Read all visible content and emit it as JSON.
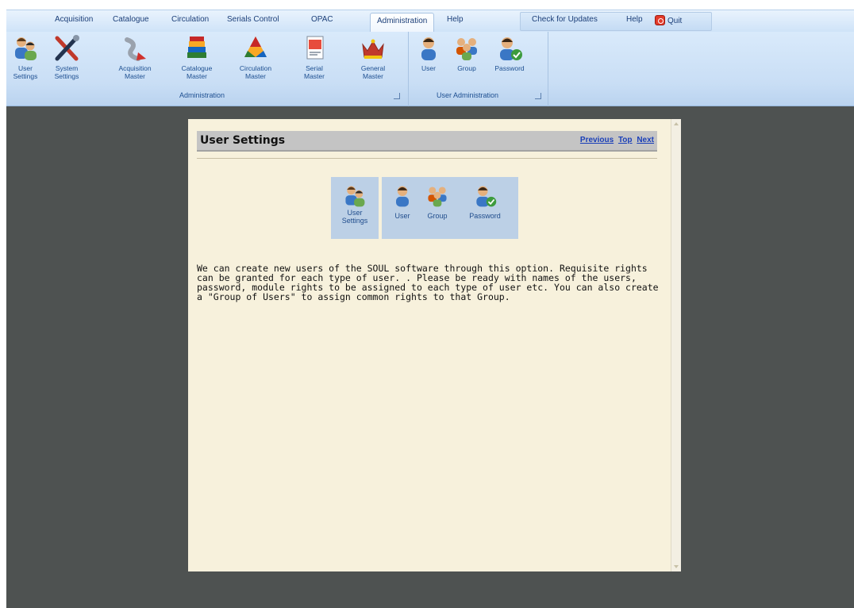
{
  "tabs": [
    {
      "label": "Acquisition",
      "active": false
    },
    {
      "label": "Catalogue",
      "active": false
    },
    {
      "label": "Circulation",
      "active": false
    },
    {
      "label": "Serials Control",
      "active": false
    },
    {
      "label": "OPAC",
      "active": false
    },
    {
      "label": "Administration",
      "active": true
    },
    {
      "label": "Help",
      "active": false
    }
  ],
  "top_right": {
    "check_updates": "Check for Updates",
    "help": "Help",
    "quit": "Quit"
  },
  "ribbon": {
    "admin_group": {
      "label": "Administration",
      "buttons": [
        {
          "line1": "User",
          "line2": "Settings",
          "icon": "users-icon"
        },
        {
          "line1": "System",
          "line2": "Settings",
          "icon": "tools-icon"
        },
        {
          "line1": "Acquisition",
          "line2": "Master",
          "icon": "acquisition-icon"
        },
        {
          "line1": "Catalogue",
          "line2": "Master",
          "icon": "books-icon"
        },
        {
          "line1": "Circulation",
          "line2": "Master",
          "icon": "circulation-icon"
        },
        {
          "line1": "Serial",
          "line2": "Master",
          "icon": "serial-icon"
        },
        {
          "line1": "General",
          "line2": "Master",
          "icon": "crown-icon"
        }
      ]
    },
    "user_admin_group": {
      "label": "User Administration",
      "buttons": [
        {
          "line1": "User",
          "icon": "user-icon"
        },
        {
          "line1": "Group",
          "icon": "group-icon"
        },
        {
          "line1": "Password",
          "icon": "password-icon"
        }
      ]
    }
  },
  "page": {
    "title": "User Settings",
    "nav": {
      "previous": "Previous",
      "top": "Top",
      "next": "Next"
    },
    "quick_icons": {
      "user_settings": {
        "line1": "User",
        "line2": "Settings"
      },
      "user": "User",
      "group": "Group",
      "password": "Password"
    },
    "description": "We can create new users of the SOUL software through this option.  Requisite rights can be granted for each type of user.  .  Please be ready with names of the users, password, module rights to be assigned to each type of user etc.  You can also create a \"Group of Users\" to assign common rights to that Group."
  },
  "colors": {
    "ribbon_bg": "#c9def5",
    "workspace_bg": "#4e5251",
    "panel_bg": "#f7f1dc",
    "link": "#1a3fb8"
  }
}
